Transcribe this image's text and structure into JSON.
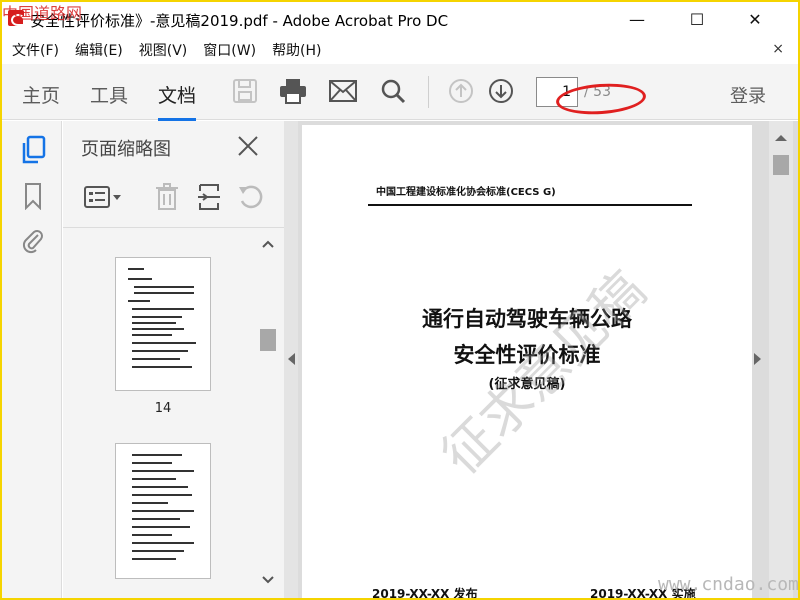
{
  "window": {
    "title": "安全性评价标准》-意见稿2019.pdf - Adobe Acrobat Pro DC",
    "minimize": "—",
    "maximize": "☐",
    "close": "✕"
  },
  "menu": {
    "items": [
      "文件(F)",
      "编辑(E)",
      "视图(V)",
      "窗口(W)",
      "帮助(H)"
    ],
    "close": "×"
  },
  "toolbar": {
    "tabs": [
      "主页",
      "工具",
      "文档"
    ],
    "active_tab": "文档",
    "page_current": "1",
    "page_total": "/ 53",
    "login": "登录",
    "icons": [
      "save-icon",
      "print-icon",
      "email-icon",
      "search-icon",
      "page-up-icon",
      "page-down-icon"
    ]
  },
  "left_rail": {
    "icons": [
      "page-thumbnails-icon",
      "bookmark-icon",
      "attachment-icon"
    ]
  },
  "thumbnails_panel": {
    "title": "页面缩略图",
    "thumbnails": [
      {
        "label": "14"
      },
      {
        "label": ""
      }
    ]
  },
  "document": {
    "header": "中国工程建设标准化协会标准(CECS G)",
    "title_line1": "通行自动驾驶车辆公路",
    "title_line2": "安全性评价标准",
    "subtitle": "(征求意见稿)",
    "watermark": "征求意见稿",
    "footer_left": "2019-XX-XX 发布",
    "footer_right": "2019-XX-XX 实施"
  },
  "overlay": {
    "site_mark_top": "中国道路网",
    "site_mark_bottom": "www.cndao.com",
    "annotation_color": "#e02020"
  },
  "colors": {
    "accent": "#1473e6",
    "border_frame": "#f5d400"
  }
}
